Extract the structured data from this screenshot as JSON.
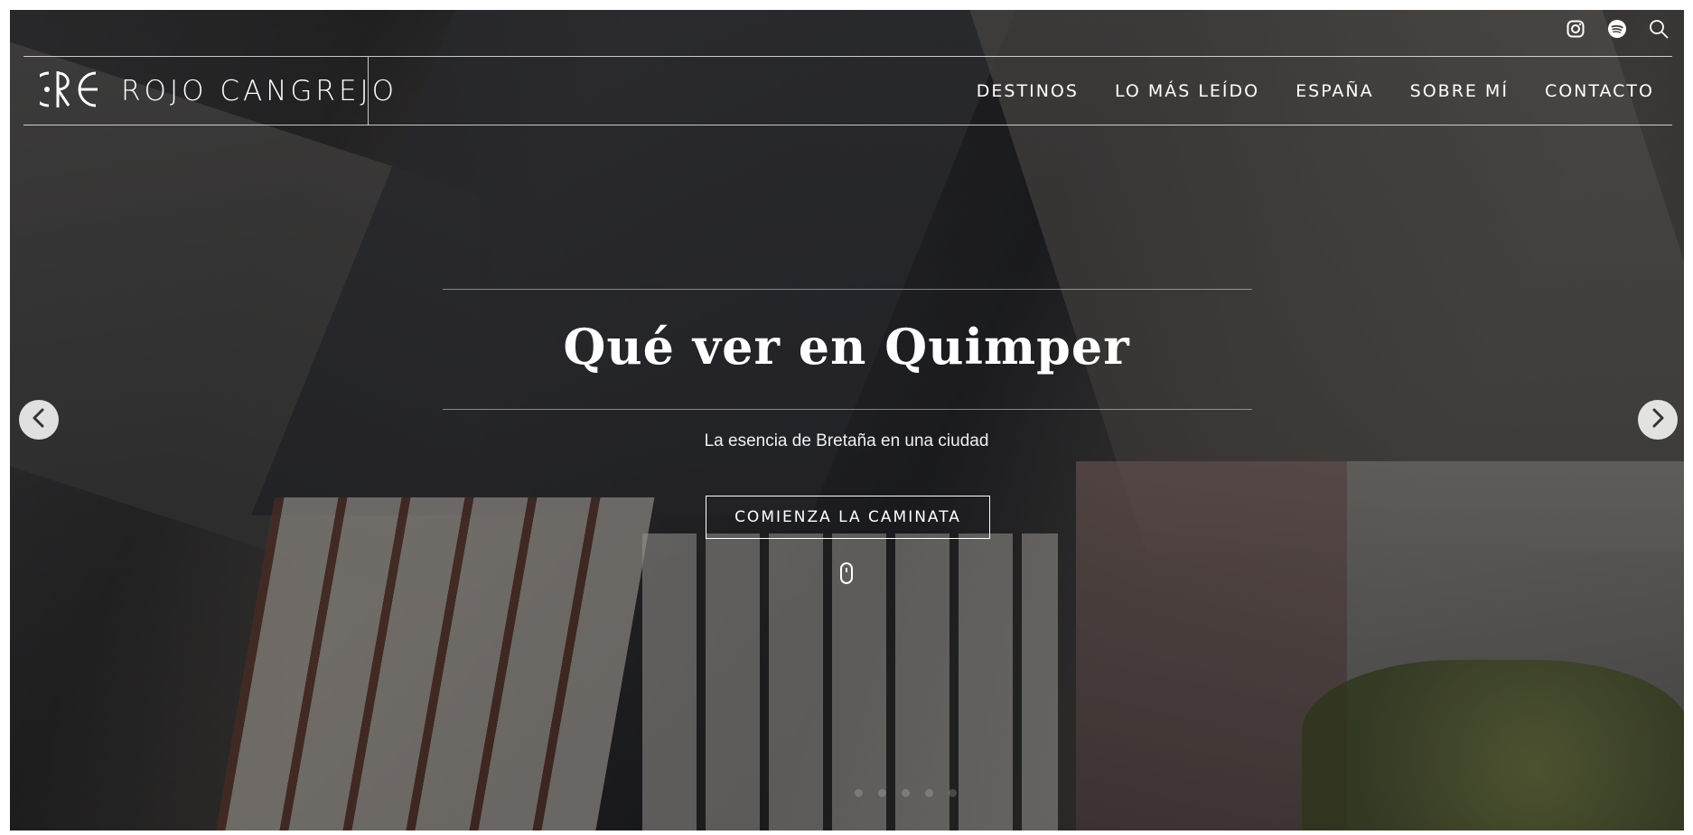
{
  "brand": {
    "name": "ROJO CANGREJO"
  },
  "utility_icons": [
    "instagram-icon",
    "spotify-icon",
    "search-icon"
  ],
  "nav": {
    "items": [
      {
        "label": "DESTINOS"
      },
      {
        "label": "LO MÁS LEÍDO"
      },
      {
        "label": "ESPAÑA"
      },
      {
        "label": "SOBRE MÍ"
      },
      {
        "label": "CONTACTO"
      }
    ]
  },
  "hero": {
    "title": "Qué ver en Quimper",
    "subtitle": "La esencia de Bretaña en una ciudad",
    "cta_label": "COMIENZA LA CAMINATA"
  },
  "slider": {
    "dot_count": 5,
    "active_index": 0
  },
  "colors": {
    "text": "#ffffff",
    "arrow_bg": "#ffffff"
  }
}
